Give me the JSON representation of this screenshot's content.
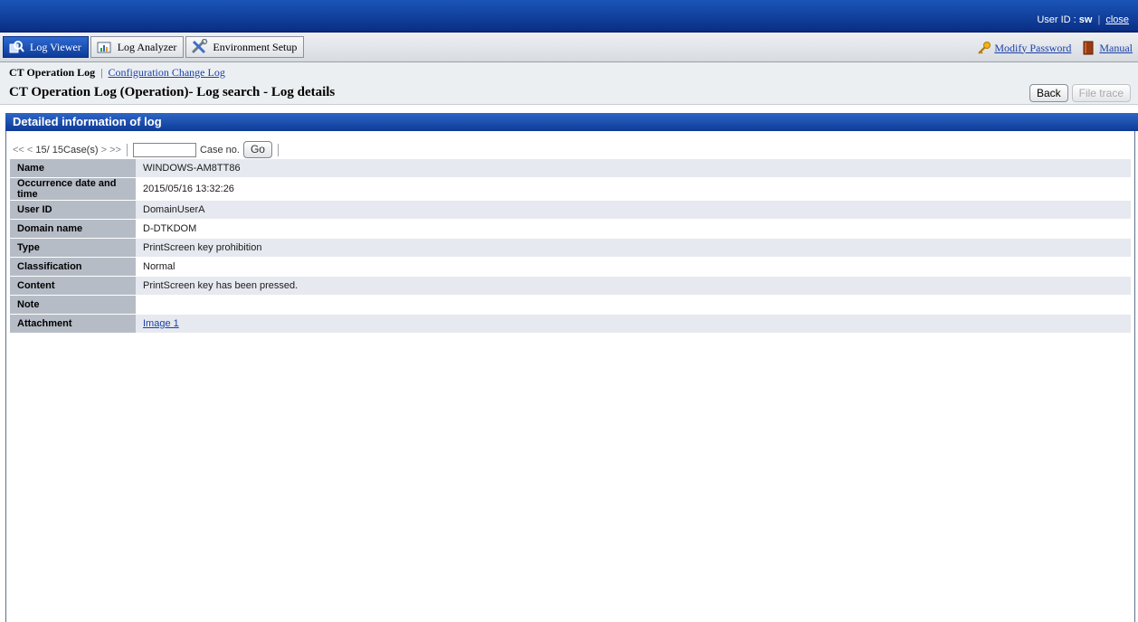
{
  "topbar": {
    "user_id_label": "User ID : ",
    "user_id_value": "sw",
    "close_label": "close"
  },
  "tabs": [
    {
      "label": "Log Viewer",
      "icon": "log-viewer-icon",
      "active": true
    },
    {
      "label": "Log Analyzer",
      "icon": "chart-icon",
      "active": false
    },
    {
      "label": "Environment Setup",
      "icon": "tools-icon",
      "active": false
    }
  ],
  "tabbar_right": {
    "modify_password_label": "Modify Password",
    "manual_label": "Manual"
  },
  "subnav": {
    "current": "CT Operation Log",
    "link": "Configuration Change Log"
  },
  "page": {
    "title": "CT Operation Log (Operation)- Log search - Log details",
    "back_label": "Back",
    "file_trace_label": "File trace"
  },
  "section": {
    "title": "Detailed information of log"
  },
  "pager": {
    "first": "<<",
    "prev": "<",
    "status": "15/ 15Case(s)",
    "next": ">",
    "last": ">>",
    "case_input_value": "",
    "case_label": "Case no.",
    "go_label": "Go"
  },
  "details": [
    {
      "label": "Name",
      "value": "WINDOWS-AM8TT86"
    },
    {
      "label": "Occurrence date and time",
      "value": "2015/05/16 13:32:26"
    },
    {
      "label": "User ID",
      "value": "DomainUserA"
    },
    {
      "label": "Domain name",
      "value": "D-DTKDOM"
    },
    {
      "label": "Type",
      "value": "PrintScreen key prohibition"
    },
    {
      "label": "Classification",
      "value": "Normal"
    },
    {
      "label": "Content",
      "value": "PrintScreen key has been pressed."
    },
    {
      "label": "Note",
      "value": ""
    },
    {
      "label": "Attachment",
      "value": "Image 1"
    }
  ],
  "colors": {
    "brand_blue": "#0d3a97",
    "label_cell": "#b6bcc6",
    "row_stripe": "#e6e9ef",
    "link": "#1a3fa8"
  }
}
